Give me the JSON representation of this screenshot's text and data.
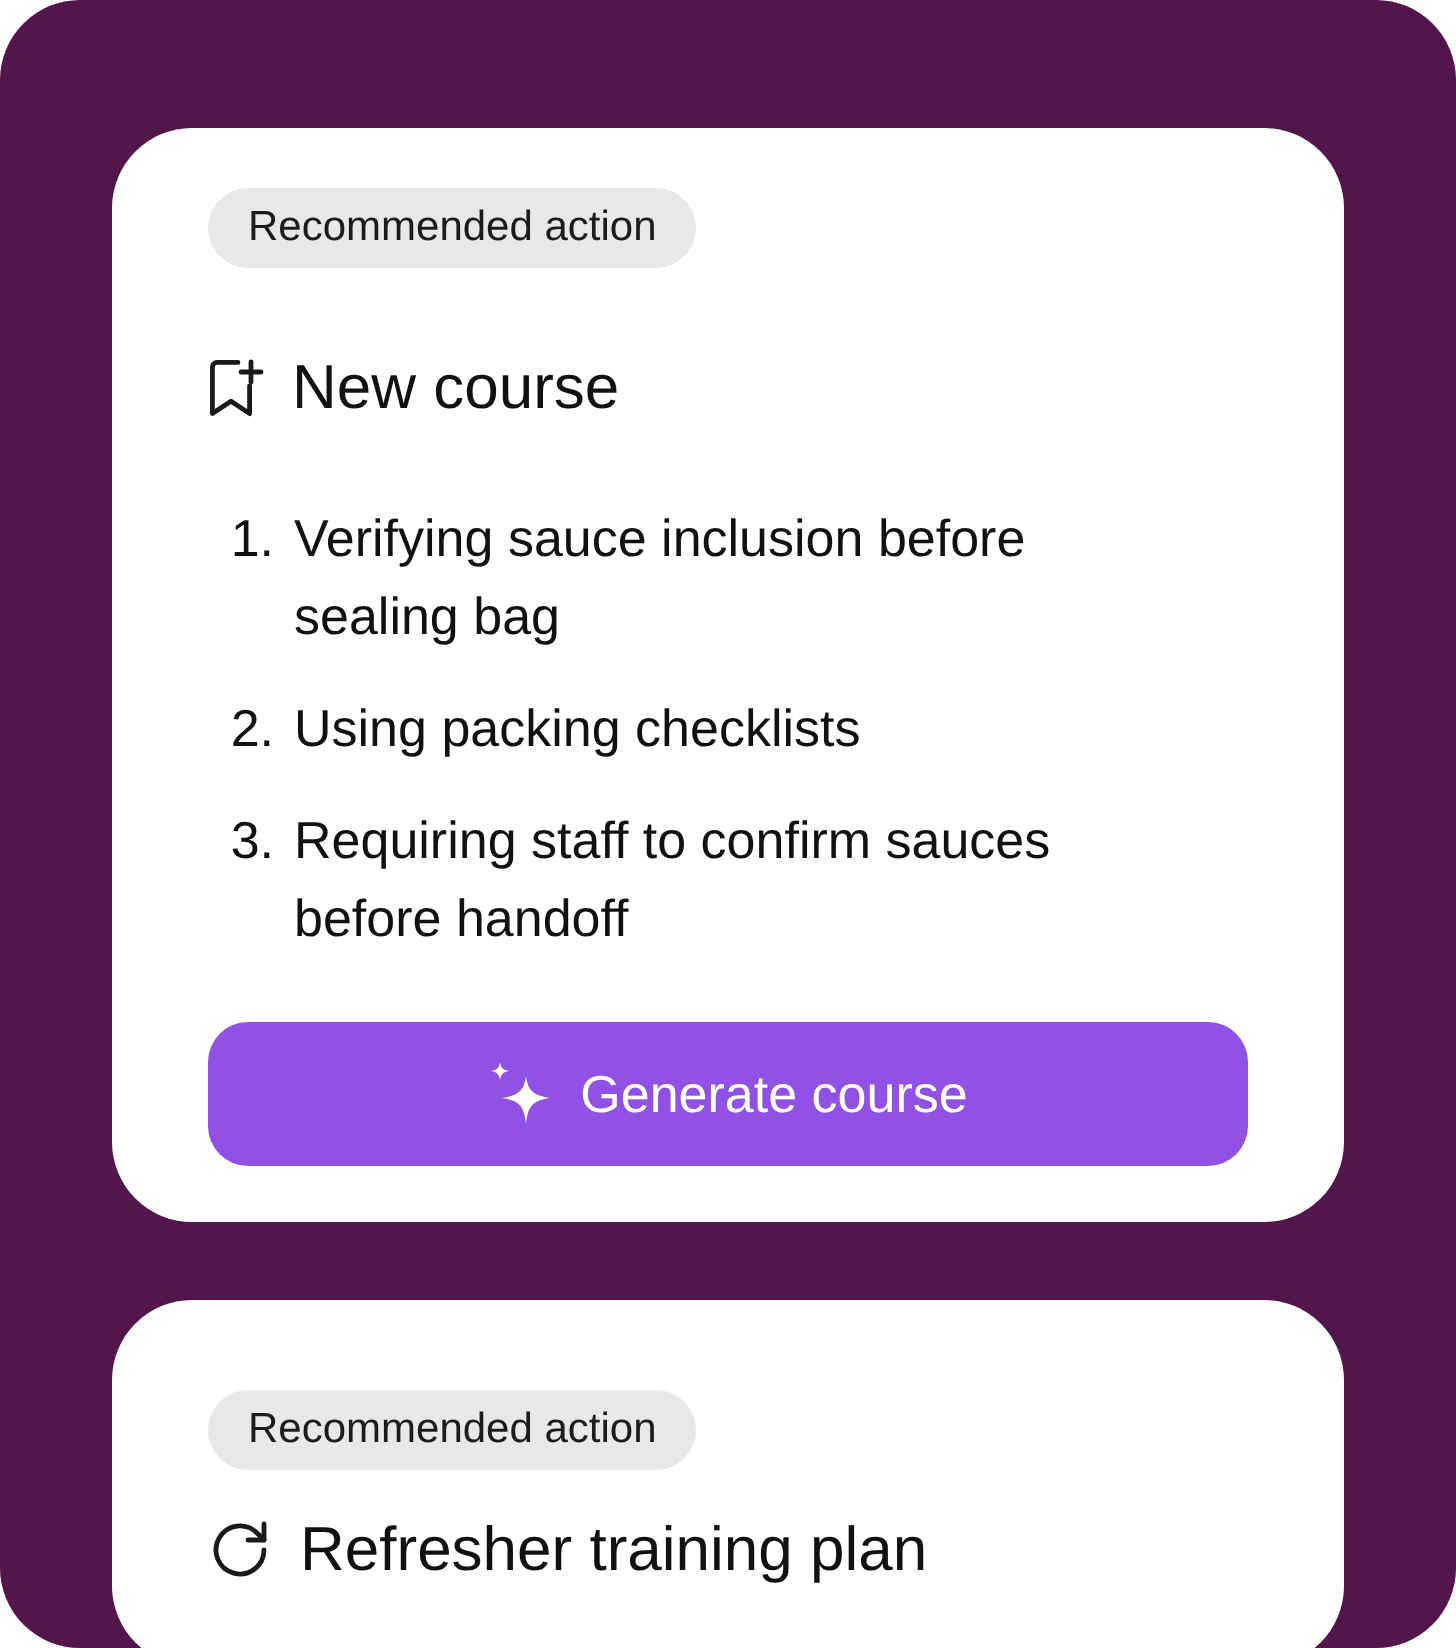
{
  "cards": [
    {
      "kind": "new_course",
      "badge": "Recommended action",
      "title": "New course",
      "steps": [
        {
          "number": "1.",
          "text": "Verifying sauce inclusion before sealing bag"
        },
        {
          "number": "2.",
          "text": "Using packing checklists"
        },
        {
          "number": "3.",
          "text": "Requiring staff to confirm sauces before handoff"
        }
      ],
      "button": {
        "label": "Generate course"
      }
    },
    {
      "kind": "refresher",
      "badge": "Recommended action",
      "title": "Refresher training plan"
    }
  ]
}
